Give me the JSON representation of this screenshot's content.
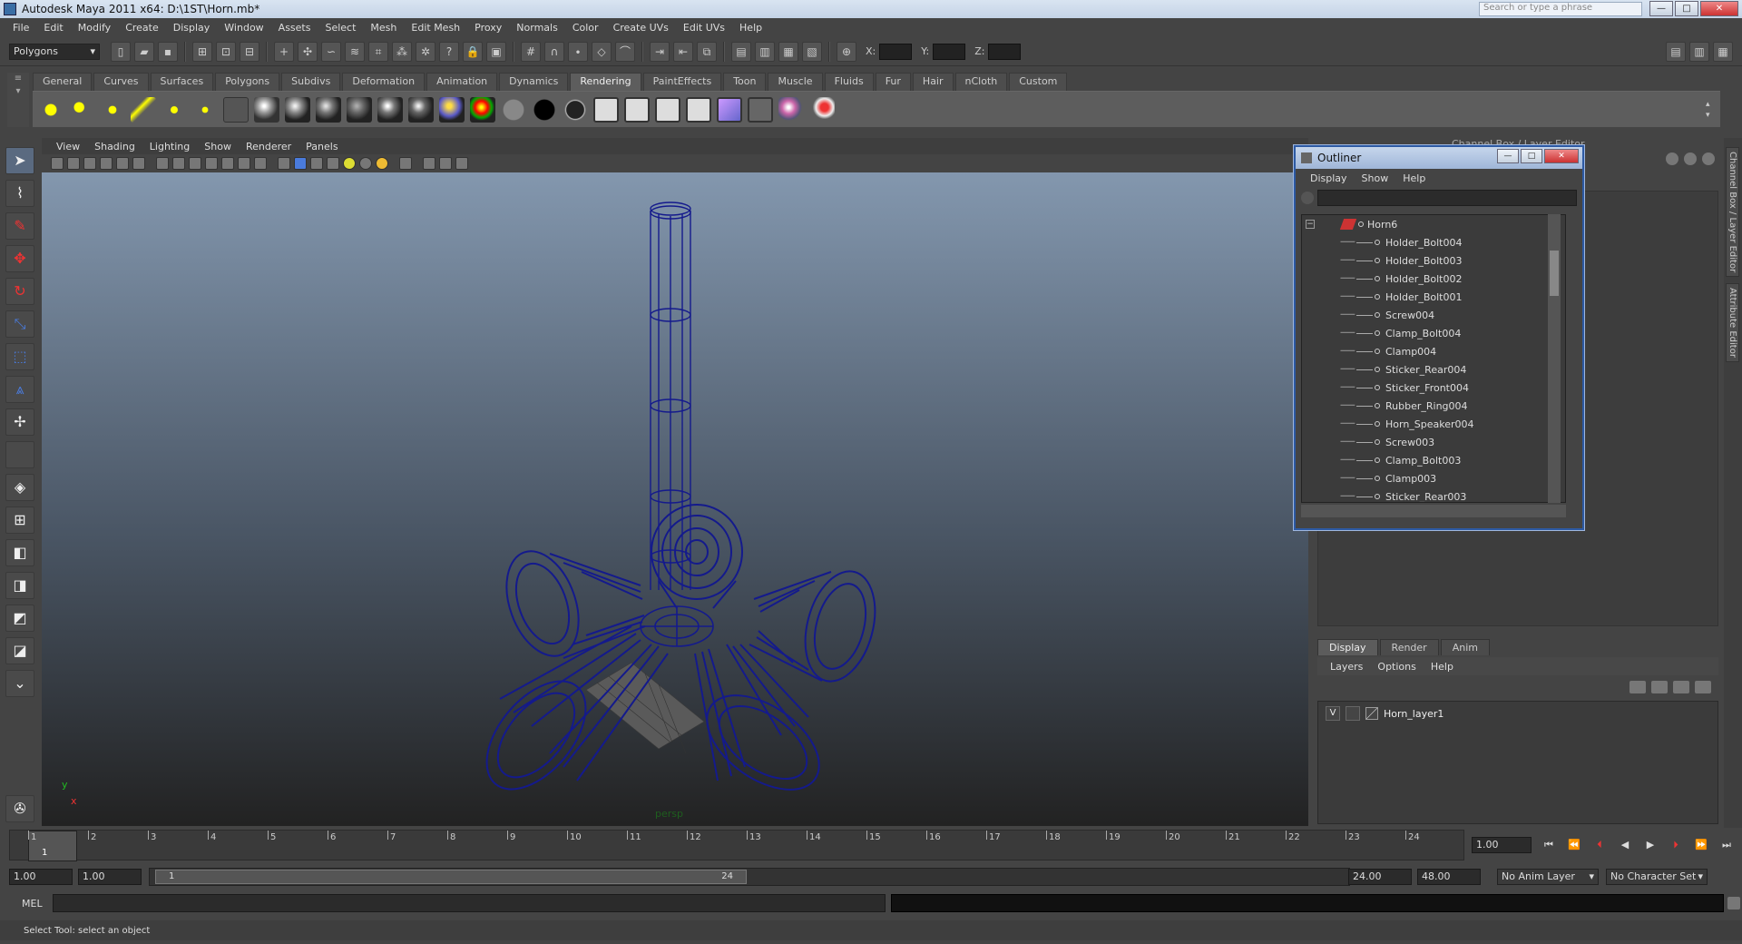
{
  "window": {
    "title": "Autodesk Maya 2011 x64: D:\\1ST\\Horn.mb*",
    "search_placeholder": "Search or type a phrase"
  },
  "menubar": [
    "File",
    "Edit",
    "Modify",
    "Create",
    "Display",
    "Window",
    "Assets",
    "Select",
    "Mesh",
    "Edit Mesh",
    "Proxy",
    "Normals",
    "Color",
    "Create UVs",
    "Edit UVs",
    "Help"
  ],
  "statusline": {
    "mode": "Polygons",
    "x_label": "X:",
    "y_label": "Y:",
    "z_label": "Z:"
  },
  "shelf": {
    "tabs": [
      "General",
      "Curves",
      "Surfaces",
      "Polygons",
      "Subdivs",
      "Deformation",
      "Animation",
      "Dynamics",
      "Rendering",
      "PaintEffects",
      "Toon",
      "Muscle",
      "Fluids",
      "Fur",
      "Hair",
      "nCloth",
      "Custom"
    ],
    "active_tab": "Rendering"
  },
  "viewport": {
    "menu": [
      "View",
      "Shading",
      "Lighting",
      "Show",
      "Renderer",
      "Panels"
    ],
    "camera": "persp",
    "axis_x": "x",
    "axis_y": "y"
  },
  "outliner": {
    "title": "Outliner",
    "menu": [
      "Display",
      "Show",
      "Help"
    ],
    "root": "Horn6",
    "items": [
      "Holder_Bolt004",
      "Holder_Bolt003",
      "Holder_Bolt002",
      "Holder_Bolt001",
      "Screw004",
      "Clamp_Bolt004",
      "Clamp004",
      "Sticker_Rear004",
      "Sticker_Front004",
      "Rubber_Ring004",
      "Horn_Speaker004",
      "Screw003",
      "Clamp_Bolt003",
      "Clamp003",
      "Sticker_Rear003"
    ]
  },
  "channel_box": {
    "title": "Channel Box / Layer Editor"
  },
  "side_tabs": [
    "Channel Box / Layer Editor",
    "Attribute Editor"
  ],
  "layer_editor": {
    "tabs": [
      "Display",
      "Render",
      "Anim"
    ],
    "active_tab": "Display",
    "menu": [
      "Layers",
      "Options",
      "Help"
    ],
    "layers": [
      {
        "visible": "V",
        "name": "Horn_layer1"
      }
    ]
  },
  "timeline": {
    "ticks": [
      "1",
      "2",
      "3",
      "4",
      "5",
      "6",
      "7",
      "8",
      "9",
      "10",
      "11",
      "12",
      "13",
      "14",
      "15",
      "16",
      "17",
      "18",
      "19",
      "20",
      "21",
      "22",
      "23",
      "24"
    ],
    "cursor_frame": "1",
    "current_time": "1.00",
    "range_start": "1.00",
    "playback_start": "1.00",
    "range_handle_start": "1",
    "range_handle_end": "24",
    "playback_end": "24.00",
    "range_end": "48.00",
    "anim_layer": "No Anim Layer",
    "character_set": "No Character Set"
  },
  "command_line": {
    "label": "MEL"
  },
  "help_line": "Select Tool: select an object",
  "colors": {
    "wireframe": "#141a8c",
    "accent_border": "#2d5aa4"
  }
}
